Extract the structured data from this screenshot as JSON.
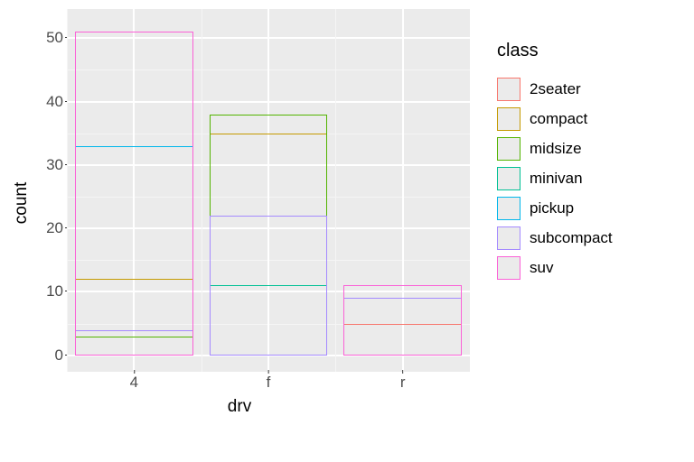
{
  "chart_data": {
    "type": "bar",
    "categories": [
      "4",
      "f",
      "r"
    ],
    "series": [
      {
        "name": "2seater",
        "values": [
          0,
          0,
          5
        ],
        "color": "#F8766D"
      },
      {
        "name": "compact",
        "values": [
          12,
          35,
          0
        ],
        "color": "#C49A00"
      },
      {
        "name": "midsize",
        "values": [
          3,
          38,
          0
        ],
        "color": "#53B400"
      },
      {
        "name": "minivan",
        "values": [
          0,
          11,
          0
        ],
        "color": "#00C094"
      },
      {
        "name": "pickup",
        "values": [
          33,
          0,
          0
        ],
        "color": "#00B6EB"
      },
      {
        "name": "subcompact",
        "values": [
          4,
          22,
          9
        ],
        "color": "#A58AFF"
      },
      {
        "name": "suv",
        "values": [
          51,
          0,
          11
        ],
        "color": "#FB61D7"
      }
    ],
    "title": "",
    "xlabel": "drv",
    "ylabel": "count",
    "ylim": [
      0,
      52
    ],
    "ybreaks": [
      0,
      10,
      20,
      30,
      40,
      50
    ],
    "yminor": [
      5,
      15,
      25,
      35,
      45
    ],
    "legend_title": "class"
  }
}
